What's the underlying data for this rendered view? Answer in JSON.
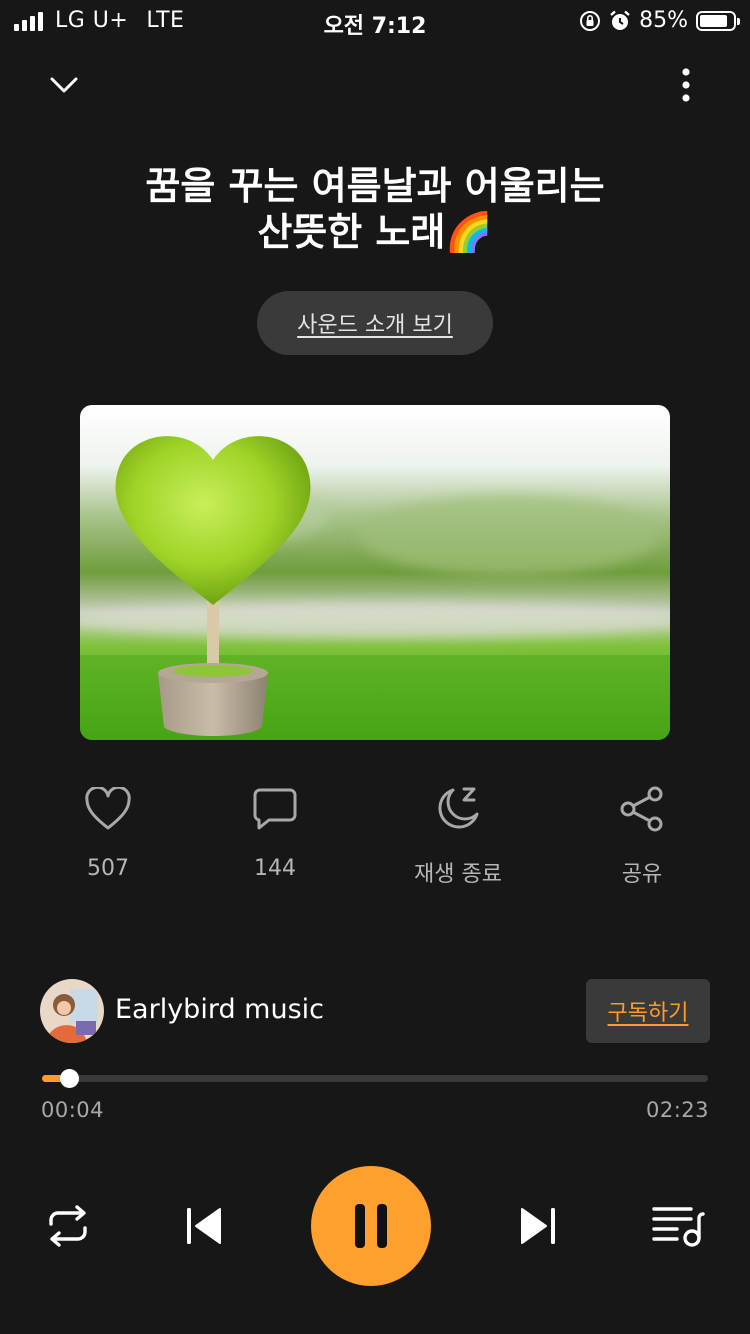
{
  "status_bar": {
    "carrier": "LG U+",
    "network": "LTE",
    "time": "오전 7:12",
    "battery": "85%",
    "battery_level": 0.85
  },
  "header": {
    "collapse_icon": "chevron-down-icon",
    "more_icon": "more-vertical-icon"
  },
  "title_line1": "꿈을 꾸는 여름날과 어울리는",
  "title_line2": "산뜻한 노래🌈",
  "intro_button": "사운드 소개 보기",
  "cover_image": "green heart-shaped topiary tree in a pot on grass",
  "actions": [
    {
      "icon": "heart-icon",
      "label": "507"
    },
    {
      "icon": "comment-icon",
      "label": "144"
    },
    {
      "icon": "sleep-timer-icon",
      "label": "재생 종료"
    },
    {
      "icon": "share-icon",
      "label": "공유"
    }
  ],
  "channel": {
    "name": "Earlybird music",
    "subscribe": "구독하기"
  },
  "player": {
    "elapsed": "00:04",
    "duration": "02:23",
    "progress": 0.028,
    "controls": [
      "repeat-icon",
      "previous-icon",
      "pause-icon",
      "next-icon",
      "playlist-icon"
    ]
  },
  "colors": {
    "background": "#171717",
    "accent": "#ff9b2b",
    "button_bg": "#3a3a3a"
  }
}
